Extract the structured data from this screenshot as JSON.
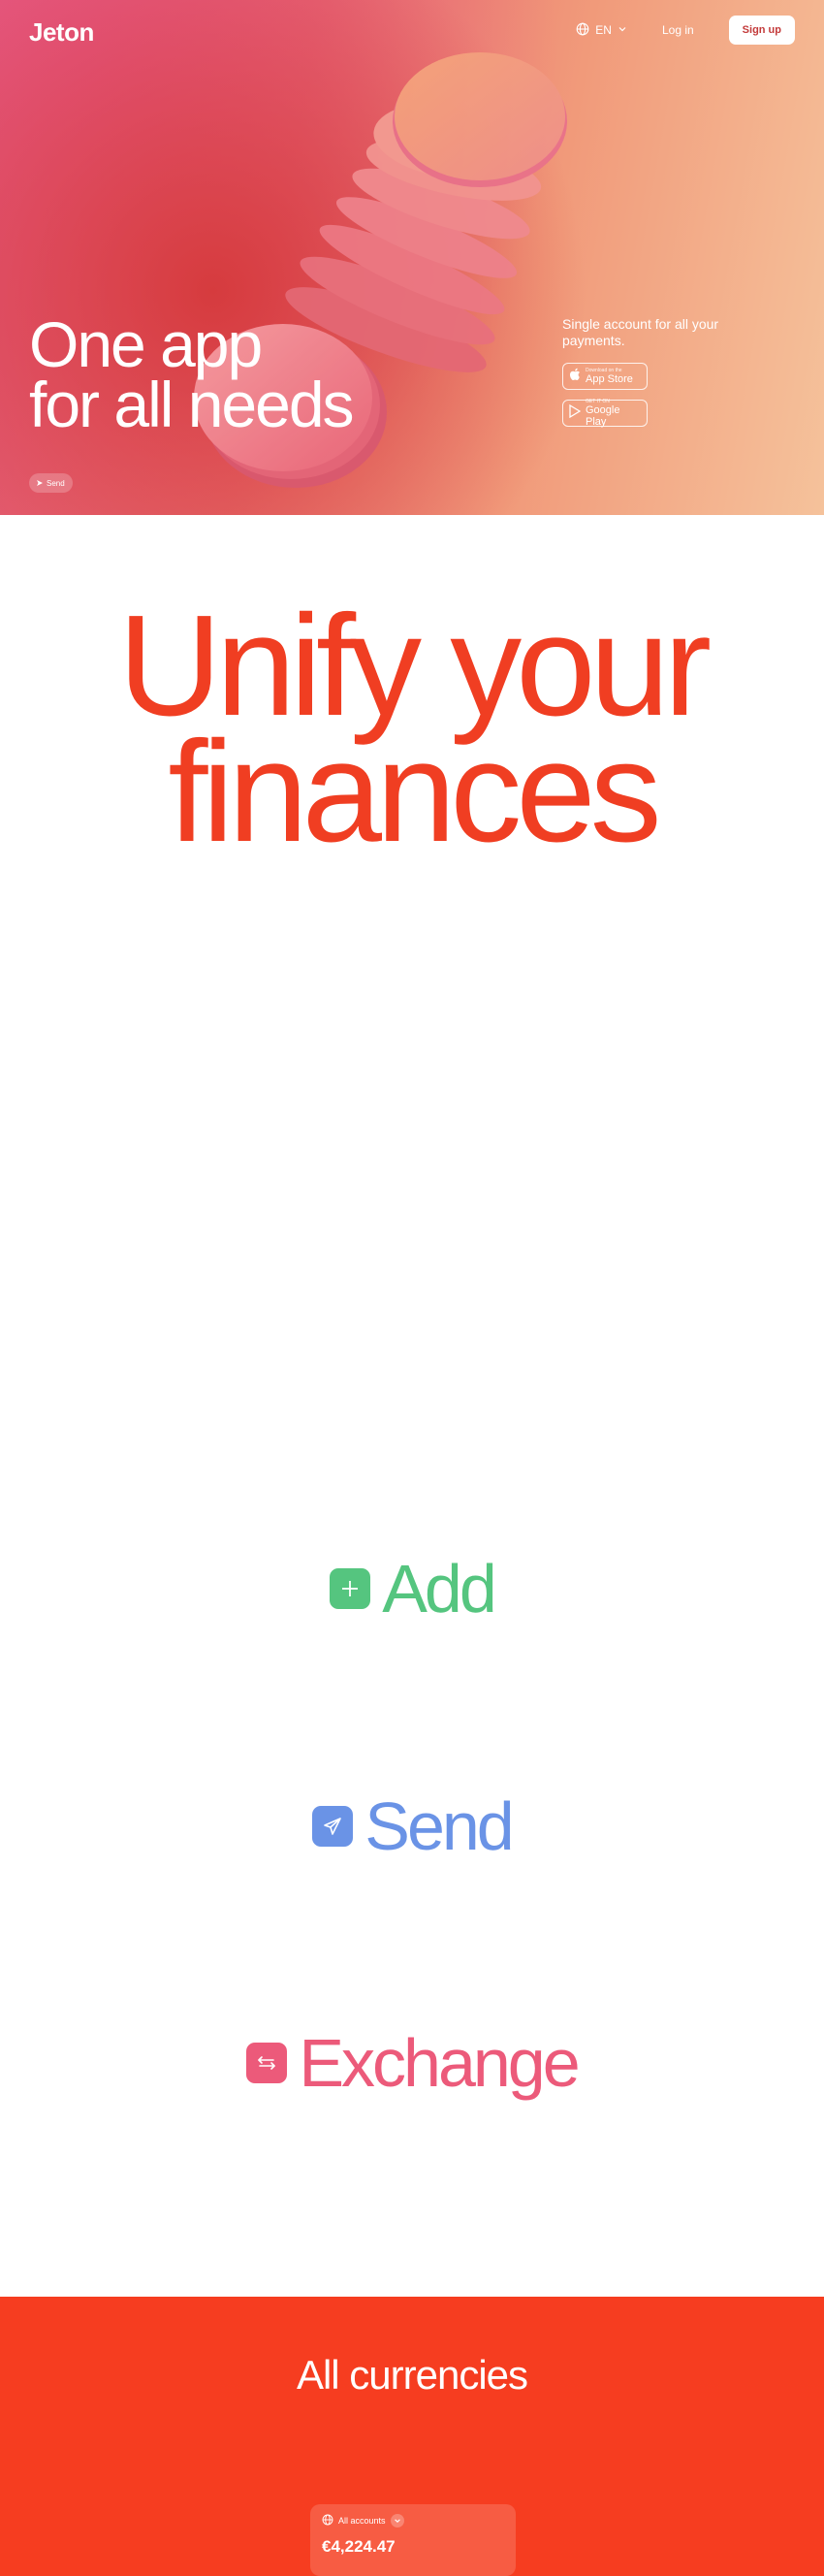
{
  "header": {
    "logo": "Jeton",
    "language": "EN",
    "login_label": "Log in",
    "signup_label": "Sign up"
  },
  "hero": {
    "title_line1": "One app",
    "title_line2": "for all needs",
    "send_chip": "Send",
    "tagline": "Single account for all your payments.",
    "app_store": {
      "small": "Download on the",
      "big": "App Store"
    },
    "google_play": {
      "small": "GET IT ON",
      "big": "Google Play"
    }
  },
  "unify": {
    "line1": "Unify your",
    "line2": "finances"
  },
  "features": [
    {
      "label": "Add",
      "color": "#55c57f",
      "icon": "plus-icon"
    },
    {
      "label": "Send",
      "color": "#6a93e6",
      "icon": "paper-plane-icon"
    },
    {
      "label": "Exchange",
      "color": "#ec5a7a",
      "icon": "exchange-arrows-icon"
    }
  ],
  "currencies": {
    "title": "All currencies",
    "account_selector": "All accounts",
    "amount": "€4,224.47"
  },
  "colors": {
    "brand_red": "#f03e22",
    "currencies_bg": "#f63d20"
  }
}
